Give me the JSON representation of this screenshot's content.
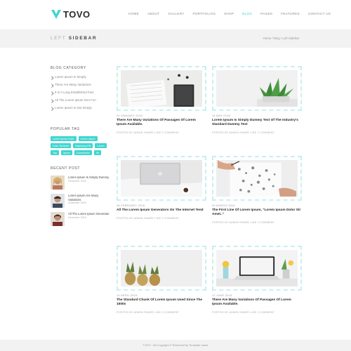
{
  "header": {
    "logo_text": "TOVO",
    "nav": [
      "HOME",
      "ABOUT",
      "GALLERY",
      "PORTFOLIOS",
      "SHOP",
      "BLOG",
      "PAGES",
      "FEATURES",
      "CONTACT US"
    ],
    "active_nav_index": 5
  },
  "title_band": {
    "title_light": "LEFT",
    "title_bold": "SIDEBAR",
    "breadcrumb": "Home / Blog / Left Sidebar"
  },
  "sidebar": {
    "category_title": "BLOG CATEGORY",
    "categories": [
      "Lorem Ipsum Is Simply",
      "There Are Many Variations",
      "It Is A Long Established Fact",
      "All The Lorem Ipsum Gen Fon",
      "Lorem Ipsum Is Not Simply"
    ],
    "popular_title": "POPULAR TAG",
    "tags": [
      "Lorem Ipsum Dolor",
      "Lorem Ipsum",
      "Dolor Sit Amet",
      "Adipiscing Elit",
      "Lorem",
      "Tag",
      "Ipsum",
      "Consectetur",
      "Sit"
    ],
    "recent_title": "RECENT POST",
    "recent": [
      {
        "title": "Lorem Ipsum Is Simply Dummy",
        "date": "December 2016"
      },
      {
        "title": "Lorem Ipsum Are Many Variations",
        "date": "December 2016"
      },
      {
        "title": "All The Lorem Ipsum Generator",
        "date": "December 2016"
      }
    ]
  },
  "posts": [
    {
      "date": "20 JANUARY 2018",
      "title": "There Are Many Variations Of Passages Of Lorem Ipsum Available.",
      "meta": "POSTED BY ADMIN   SHARE   LIKE   2 COMMENT"
    },
    {
      "date": "16 MAY 2018",
      "title": "Lorem Ipsum Is Simply Dummy Text Of The Industry's Standard Dummy Text",
      "meta": "POSTED BY ADMIN   SHARE   LIKE   2 COMMENT"
    },
    {
      "date": "08 FEBRUARY 2018",
      "title": "All The Lorem Ipsum Generators On The Internet Tend",
      "meta": "POSTED BY ADMIN   SHARE   LIKE   2 COMMENT"
    },
    {
      "date": "20 MARCH 2018",
      "title": "The First Line Of Lorem Ipsum, \"Lorem Ipsum Dolor Sit Amet..\"",
      "meta": "POSTED BY ADMIN   SHARE   LIKE   2 COMMENT"
    },
    {
      "date": "14 APRIL 2018",
      "title": "The Standard Chunk Of Lorem Ipsum Used Since The 1500s",
      "meta": "POSTED BY ADMIN   SHARE   LIKE   2 COMMENT"
    },
    {
      "date": "12 JUNE 2018",
      "title": "There Are Many Variations Of Passages Of Lorem Ipsum Available.",
      "meta": "POSTED BY ADMIN   SHARE   LIKE   2 COMMENT"
    }
  ],
  "footer": {
    "text": "TOVO · All Copyright © Reserved by Template name"
  },
  "colors": {
    "accent": "#3fd6d0",
    "frame": "#c8eff0",
    "band": "#f2f2f2"
  }
}
